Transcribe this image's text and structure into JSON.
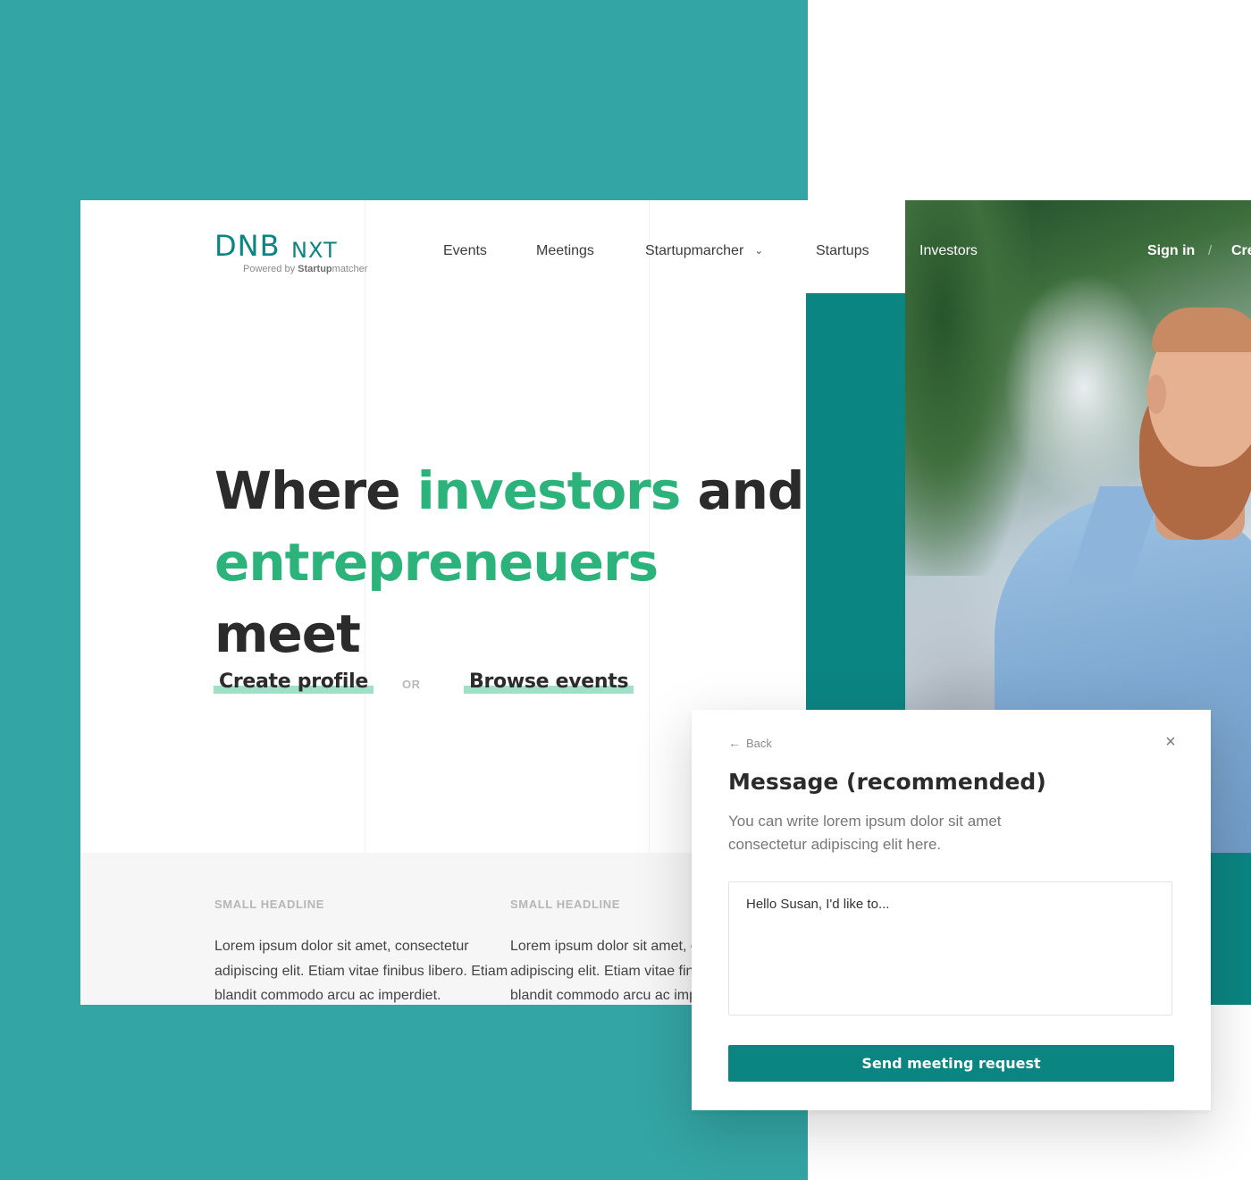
{
  "logo": {
    "brand": "DNB",
    "product": "NXT",
    "powered_prefix": "Powered by",
    "powered_name": "Startup",
    "powered_suffix": "matcher"
  },
  "nav": {
    "items": [
      {
        "label": "Events"
      },
      {
        "label": "Meetings"
      },
      {
        "label": "Startupmarcher"
      },
      {
        "label": "Startups"
      },
      {
        "label": "Investors"
      }
    ],
    "sign_in": "Sign in",
    "separator": "/",
    "create": "Cre"
  },
  "hero": {
    "w1": "Where",
    "w2": "investors",
    "w3": "and",
    "w4": "entrepreneuers",
    "w5": "meet"
  },
  "cta": {
    "create_profile": "Create profile",
    "or": "OR",
    "browse_events": "Browse events"
  },
  "columns": [
    {
      "headline": "SMALL HEADLINE",
      "body": "Lorem ipsum dolor sit amet, consectetur adipiscing elit. Etiam vitae finibus libero. Etiam blandit commodo arcu ac imperdiet."
    },
    {
      "headline": "SMALL HEADLINE",
      "body": "Lorem ipsum dolor sit amet, consectetur adipiscing elit. Etiam vitae finibus libero. Etiam blandit commodo arcu ac imperdiet."
    }
  ],
  "modal": {
    "back": "Back",
    "close_icon": "×",
    "title": "Message (recommended)",
    "subtitle": "You can write lorem ipsum dolor sit amet consectetur adipiscing elit here.",
    "message_value": "Hello Susan, I'd like to...",
    "send": "Send meeting request"
  },
  "icons": {
    "chevron": "⌄",
    "back_arrow": "←"
  },
  "colors": {
    "brand_teal": "#0b8582",
    "accent_green": "#2bb37b",
    "background_teal": "#33a5a4",
    "highlight": "#9fe0c6"
  }
}
